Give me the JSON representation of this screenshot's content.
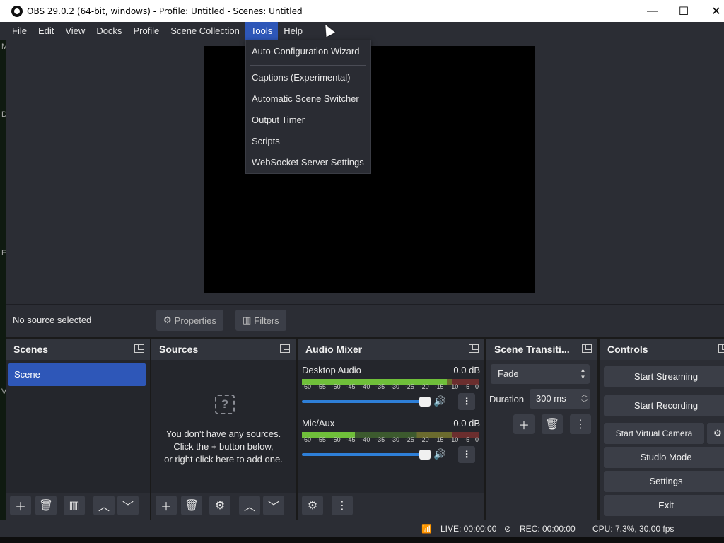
{
  "window": {
    "title": "OBS 29.0.2 (64-bit, windows) - Profile: Untitled - Scenes: Untitled",
    "minimize": "—",
    "maximize": "☐",
    "close": "✕"
  },
  "menubar": {
    "items": [
      "File",
      "Edit",
      "View",
      "Docks",
      "Profile",
      "Scene Collection",
      "Tools",
      "Help"
    ],
    "active": "Tools"
  },
  "left_strip": [
    "M",
    "D",
    "E",
    "V"
  ],
  "tools_menu": {
    "items": [
      "Auto-Configuration Wizard",
      "Captions (Experimental)",
      "Automatic Scene Switcher",
      "Output Timer",
      "Scripts",
      "WebSocket Server Settings"
    ]
  },
  "source_bar": {
    "status": "No source selected",
    "properties": "Properties",
    "filters": "Filters",
    "properties_icon": "gear-icon",
    "filters_icon": "filter-icon"
  },
  "scenes": {
    "title": "Scenes",
    "items": [
      "Scene"
    ]
  },
  "sources": {
    "title": "Sources",
    "empty_line1": "You don't have any sources.",
    "empty_line2": "Click the + button below,",
    "empty_line3": "or right click here to add one.",
    "empty_icon": "?"
  },
  "audio_mixer": {
    "title": "Audio Mixer",
    "channels": [
      {
        "name": "Desktop Audio",
        "db": "0.0 dB",
        "level": 0.82,
        "volume": 1.0
      },
      {
        "name": "Mic/Aux",
        "db": "0.0 dB",
        "level": 0.3,
        "volume": 1.0
      }
    ],
    "ticks": [
      "-60",
      "-55",
      "-50",
      "-45",
      "-40",
      "-35",
      "-30",
      "-25",
      "-20",
      "-15",
      "-10",
      "-5",
      "0"
    ]
  },
  "transitions": {
    "title": "Scene Transiti...",
    "selected": "Fade",
    "duration_label": "Duration",
    "duration_value": "300 ms"
  },
  "controls": {
    "title": "Controls",
    "start_streaming": "Start Streaming",
    "start_recording": "Start Recording",
    "start_virtual_camera": "Start Virtual Camera",
    "studio_mode": "Studio Mode",
    "settings": "Settings",
    "exit": "Exit"
  },
  "status": {
    "live": "LIVE: 00:00:00",
    "rec": "REC: 00:00:00",
    "cpu": "CPU: 7.3%, 30.00 fps"
  },
  "colors": {
    "accent": "#2e57b8",
    "panel": "#2b2d34",
    "dock_body": "#24262c",
    "button": "#3b3e47"
  }
}
